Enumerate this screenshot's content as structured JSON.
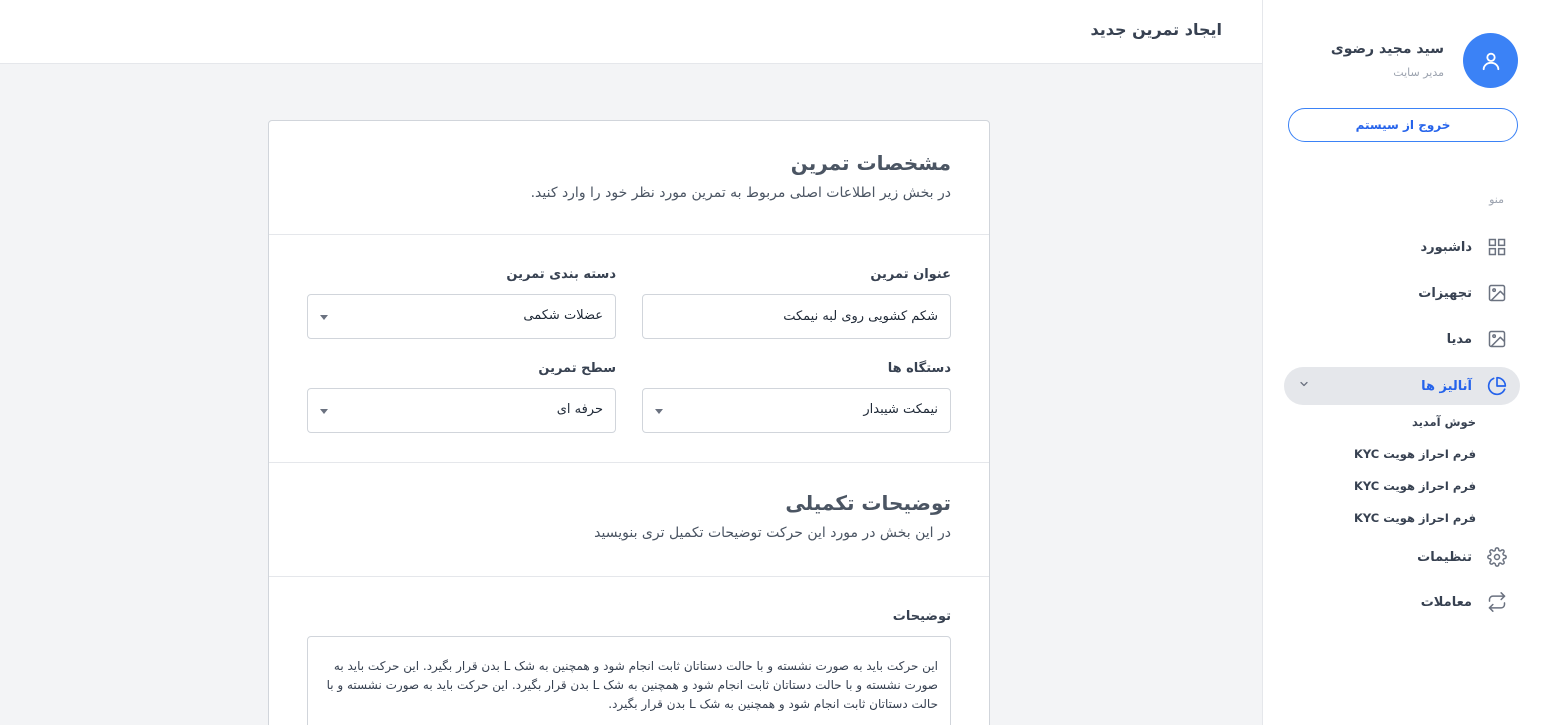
{
  "header": {
    "title": "ایجاد تمرین جدید"
  },
  "profile": {
    "name": "سید مجید رضوی",
    "role": "مدیر سایت",
    "logout_label": "خروج از سیستم"
  },
  "sidebar": {
    "menu_heading": "منو",
    "items": [
      {
        "label": "داشبورد",
        "icon": "grid-icon"
      },
      {
        "label": "تجهیزات",
        "icon": "image-icon"
      },
      {
        "label": "مدیا",
        "icon": "image-icon"
      },
      {
        "label": "آنالیز ها",
        "icon": "pie-chart-icon",
        "expanded": true
      },
      {
        "label": "تنظیمات",
        "icon": "gear-icon"
      },
      {
        "label": "معاملات",
        "icon": "repeat-icon"
      }
    ],
    "sub_items": [
      {
        "label": "خوش آمدید"
      },
      {
        "label": "فرم احراز هویت KYC"
      },
      {
        "label": "فرم احراز هویت KYC"
      },
      {
        "label": "فرم احراز هویت KYC"
      }
    ]
  },
  "form": {
    "section1": {
      "title": "مشخصات تمرین",
      "subtitle": "در بخش زیر اطلاعات اصلی مربوط به تمرین مورد نظر خود را وارد کنید."
    },
    "exercise_title": {
      "label": "عنوان تمرین",
      "value": "شکم کشویی روی لبه نیمکت"
    },
    "category": {
      "label": "دسته بندی تمرین",
      "value": "عضلات شکمی"
    },
    "equipment": {
      "label": "دستگاه ها",
      "value": "نیمکت شیبدار"
    },
    "level": {
      "label": "سطح تمرین",
      "value": "حرفه ای"
    },
    "section2": {
      "title": "توضیحات تکمیلی",
      "subtitle": "در این بخش در مورد این حرکت توضیحات تکمیل تری بنویسید"
    },
    "description": {
      "label": "توضیحات",
      "value": "این حرکت باید به صورت نشسته و با حالت دستاتان ثابت انجام شود و همچنین به شک L بدن قرار بگیرد. این حرکت باید به صورت نشسته و با حالت دستاتان ثابت انجام شود و همچنین به شک L بدن قرار بگیرد. این حرکت باید به صورت نشسته و با حالت دستاتان ثابت انجام شود و همچنین به شک L بدن قرار بگیرد."
    }
  },
  "colors": {
    "accent": "#3b82f6",
    "active_bg": "#e5e7eb",
    "page_bg": "#f3f4f6"
  }
}
